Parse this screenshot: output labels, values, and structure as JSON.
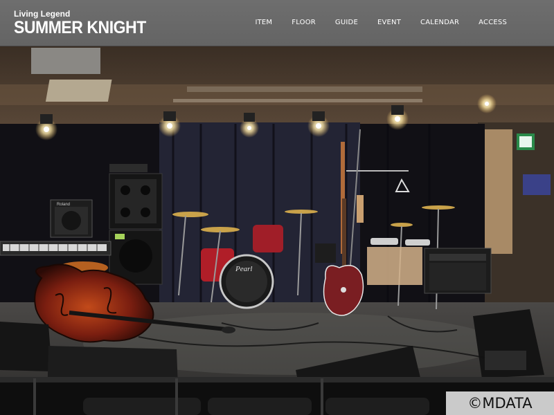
{
  "header": {
    "logo_sub": "Living Legend",
    "logo_main": "SUMMER KNIGHT"
  },
  "nav": {
    "items": [
      {
        "label": "ITEM"
      },
      {
        "label": "FLOOR"
      },
      {
        "label": "GUIDE"
      },
      {
        "label": "EVENT"
      },
      {
        "label": "CALENDAR"
      },
      {
        "label": "ACCESS"
      }
    ]
  },
  "photo": {
    "amp_brand": "Roland",
    "drum_brand": "Pearl",
    "watermark": "©MDATA"
  },
  "colors": {
    "header_bg": "#666666",
    "nav_text": "#ffffff"
  }
}
